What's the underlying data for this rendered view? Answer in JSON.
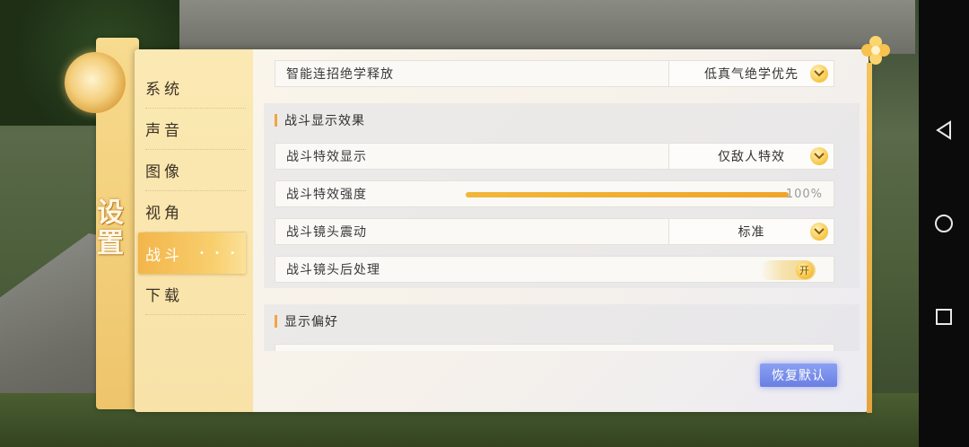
{
  "window": {
    "title_chars": [
      "设",
      "置"
    ]
  },
  "sidebar": {
    "items": [
      {
        "label": "系统"
      },
      {
        "label": "声音"
      },
      {
        "label": "图像"
      },
      {
        "label": "视角"
      },
      {
        "label": "战斗",
        "active": true
      },
      {
        "label": "下载"
      }
    ]
  },
  "settings": {
    "combo_release": {
      "label": "智能连招绝学释放",
      "value": "低真气绝学优先"
    },
    "battle_display_section": {
      "title": "战斗显示效果"
    },
    "effect_display": {
      "label": "战斗特效显示",
      "value": "仅敌人特效"
    },
    "effect_intensity": {
      "label": "战斗特效强度",
      "value": "100%",
      "fraction": 1.0
    },
    "camera_shake": {
      "label": "战斗镜头震动",
      "value": "标准"
    },
    "camera_postprocess": {
      "label": "战斗镜头后处理",
      "toggle_text": "开",
      "on": true
    },
    "display_pref_section": {
      "title": "显示偏好"
    }
  },
  "buttons": {
    "restore_default": "恢复默认"
  },
  "navbar": {
    "icons": [
      "back-icon",
      "home-icon",
      "recents-icon"
    ]
  },
  "colors": {
    "accent": "#f0a52a",
    "active_tab": "#f3b54a",
    "restore_button": "#6a7fe4"
  }
}
